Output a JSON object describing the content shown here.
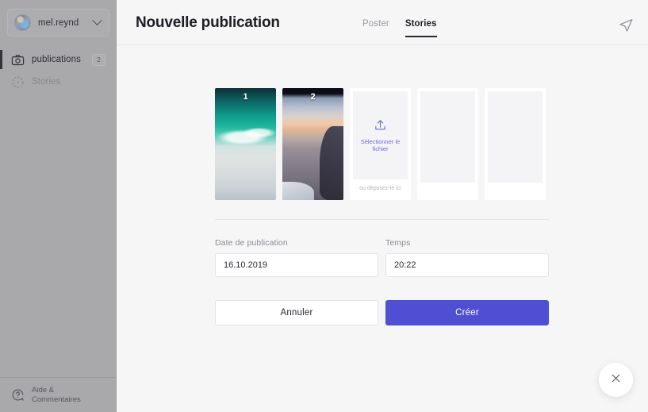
{
  "sidebar": {
    "account": {
      "name": "mel.reynd",
      "chevron_icon": "chevron-down-icon",
      "avatar_icon": "avatar"
    },
    "items": [
      {
        "label": "publications",
        "icon": "camera-icon",
        "badge": "2",
        "active": true
      },
      {
        "label": "Stories",
        "icon": "story-circle-icon",
        "badge": "",
        "active": false
      }
    ],
    "help": {
      "label": "Aide &\nCommentaires",
      "icon": "help-circle-icon"
    }
  },
  "header": {
    "title": "Nouvelle publication",
    "tabs": [
      {
        "label": "Poster",
        "active": false
      },
      {
        "label": "Stories",
        "active": true
      }
    ],
    "send_icon": "send-icon"
  },
  "media": {
    "slots": [
      {
        "number": "1",
        "type": "image",
        "subject": "ocean-beach"
      },
      {
        "number": "2",
        "type": "image",
        "subject": "city-aerial-sunset"
      }
    ],
    "upload": {
      "icon": "upload-arrow-icon",
      "select_label": "Sélectionner le fichier",
      "drop_label": "ou déposez-le ici"
    },
    "empty_slots": 2
  },
  "form": {
    "date": {
      "label": "Date de publication",
      "value": "16.10.2019",
      "placeholder": ""
    },
    "time": {
      "label": "Temps",
      "value": "20:22",
      "placeholder": ""
    }
  },
  "actions": {
    "cancel_label": "Annuler",
    "create_label": "Créer"
  },
  "fab": {
    "icon": "close-icon"
  },
  "colors": {
    "accent": "#504fd4",
    "upload_link": "#6b6bd6",
    "sidebar_bg": "#a9a9ac",
    "main_bg": "#f6f6f7"
  }
}
